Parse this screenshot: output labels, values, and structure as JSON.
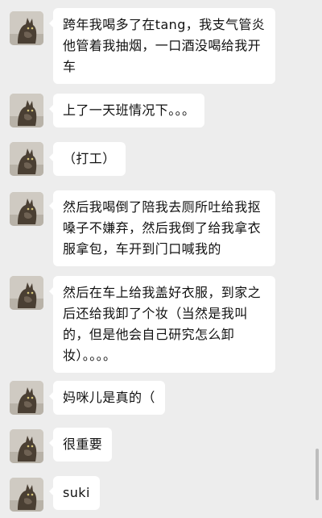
{
  "messages": [
    {
      "text": "跨年我喝多了在tang，我支气管炎他管着我抽烟，一口酒没喝给我开车"
    },
    {
      "text": "上了一天班情况下。。。"
    },
    {
      "text": "（打工）"
    },
    {
      "text": "然后我喝倒了陪我去厕所吐给我抠嗓子不嫌弃，然后我倒了给我拿衣服拿包，车开到门口喊我的"
    },
    {
      "text": "然后在车上给我盖好衣服，到家之后还给我卸了个妆（当然是我叫的，但是他会自己研究怎么卸妆）。。。。"
    },
    {
      "text": "妈咪儿是真的（"
    },
    {
      "text": "很重要"
    },
    {
      "text": "suki"
    }
  ],
  "colors": {
    "background": "#ededed",
    "bubble": "#ffffff",
    "text": "#111111"
  },
  "icons": {
    "avatar": "cat-avatar-icon"
  }
}
